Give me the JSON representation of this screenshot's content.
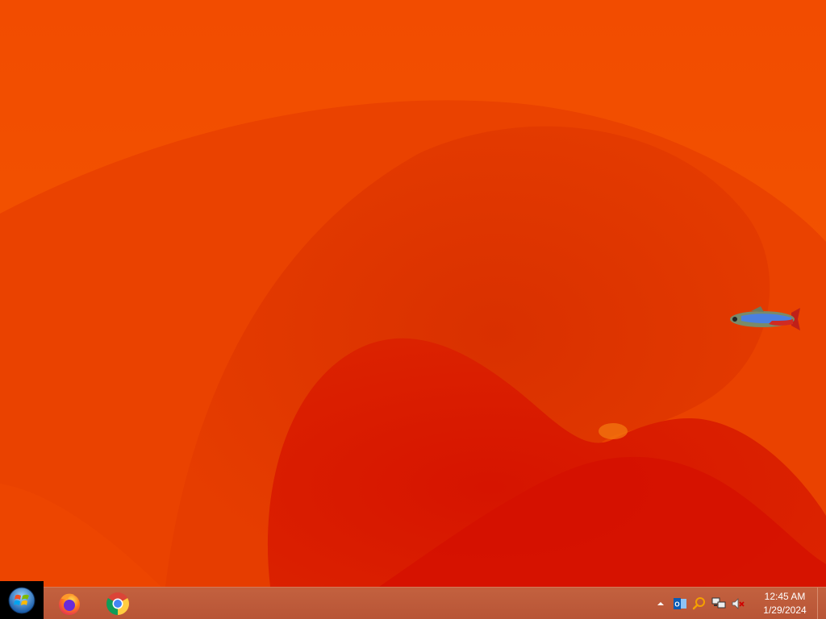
{
  "desktop": {
    "wallpaper": "orange-abstract-waves",
    "colors": {
      "base": "#e84400",
      "light": "#f05a00",
      "deep": "#d61200",
      "taskbar": "#bd5a3a"
    },
    "desktop_pet": "neon-tetra-fish-icon",
    "cursor": "hourglass-busy-icon"
  },
  "taskbar": {
    "start_button": "windows-start-orb-icon",
    "pinned_apps": [
      {
        "name": "Firefox",
        "icon": "firefox-icon"
      },
      {
        "name": "Google Chrome",
        "icon": "chrome-icon"
      }
    ],
    "tray": {
      "icons": [
        "show-hidden-icons-chevron",
        "outlook-icon",
        "search-magnifier-icon",
        "network-icon",
        "volume-muted-icon"
      ],
      "time": "12:45 AM",
      "date": "1/29/2024"
    }
  }
}
